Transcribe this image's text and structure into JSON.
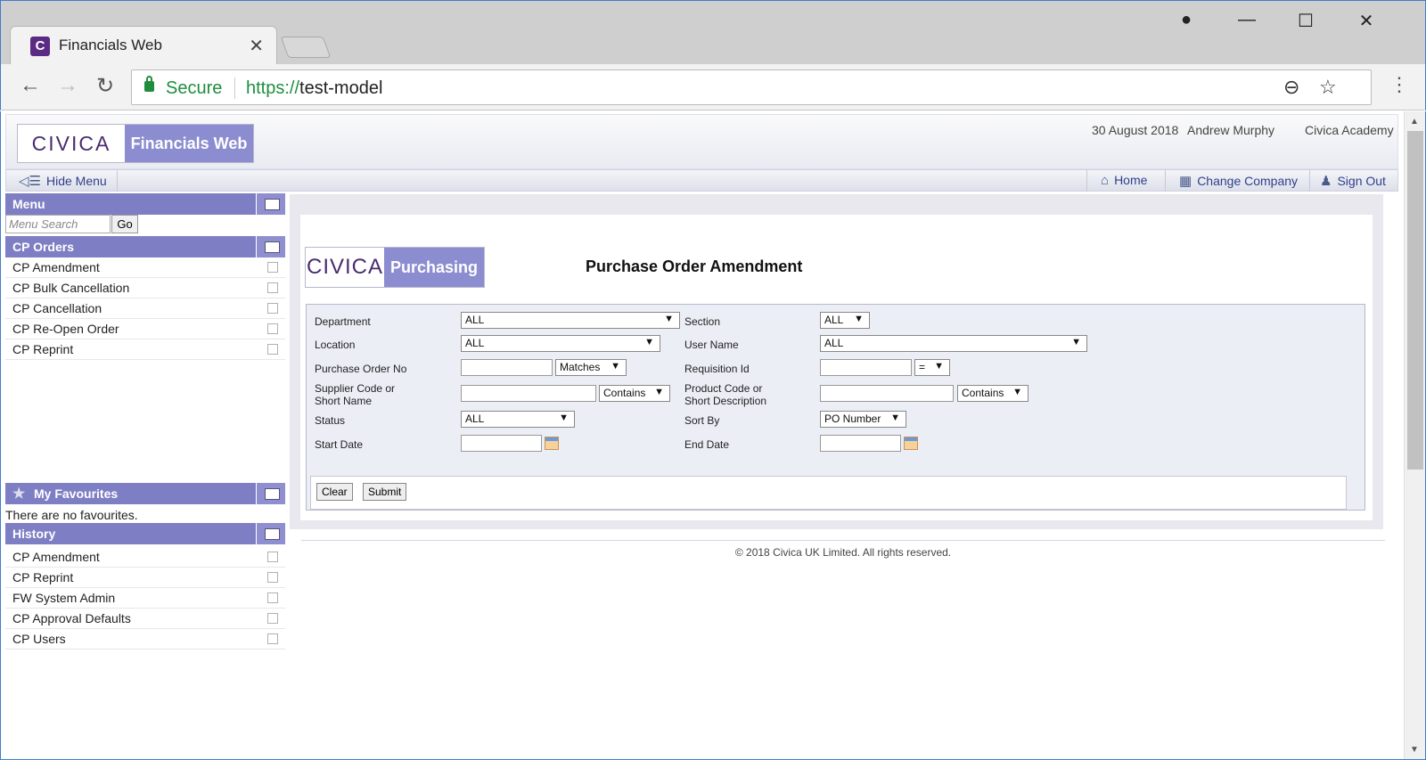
{
  "browser": {
    "tab_title": "Financials Web",
    "tab_favicon_letter": "C",
    "secure_label": "Secure",
    "url_scheme": "https://",
    "url_host": "test-model"
  },
  "header": {
    "logo_brand": "CIVICA",
    "logo_product": "Financials Web",
    "date": "30 August 2018",
    "user": "Andrew Murphy",
    "company": "Civica Academy"
  },
  "nav": {
    "hide_menu": "Hide Menu",
    "home": "Home",
    "change_company": "Change Company",
    "sign_out": "Sign Out"
  },
  "sidebar": {
    "menu_title": "Menu",
    "search_placeholder": "Menu Search",
    "go_label": "Go",
    "section_title": "CP Orders",
    "items": [
      "CP Amendment",
      "CP Bulk Cancellation",
      "CP Cancellation",
      "CP Re-Open Order",
      "CP Reprint"
    ],
    "favourites_title": "My Favourites",
    "favourites_empty": "There are no favourites.",
    "history_title": "History",
    "history": [
      "CP Amendment",
      "CP Reprint",
      "FW System Admin",
      "CP Approval Defaults",
      "CP Users"
    ]
  },
  "form": {
    "logo_brand": "CIVICA",
    "logo_product": "Purchasing",
    "title": "Purchase Order Amendment",
    "department_label": "Department",
    "department_value": "ALL",
    "section_label": "Section",
    "section_value": "ALL",
    "location_label": "Location",
    "location_value": "ALL",
    "username_label": "User Name",
    "username_value": "ALL",
    "po_label": "Purchase Order No",
    "po_match": "Matches",
    "req_label": "Requisition Id",
    "req_match": "=",
    "supplier_label_1": "Supplier Code or",
    "supplier_label_2": "Short Name",
    "supplier_match": "Contains",
    "product_label_1": "Product Code or",
    "product_label_2": "Short Description",
    "product_match": "Contains",
    "status_label": "Status",
    "status_value": "ALL",
    "sortby_label": "Sort By",
    "sortby_value": "PO Number",
    "start_label": "Start Date",
    "end_label": "End Date",
    "clear": "Clear",
    "submit": "Submit"
  },
  "footer": {
    "copyright": "© 2018 Civica UK Limited. All rights reserved."
  },
  "colors": {
    "accent": "#8c8cd0",
    "panel_header": "#7e7ec4",
    "link": "#2f3f8a",
    "secure_green": "#1e8e3e"
  }
}
